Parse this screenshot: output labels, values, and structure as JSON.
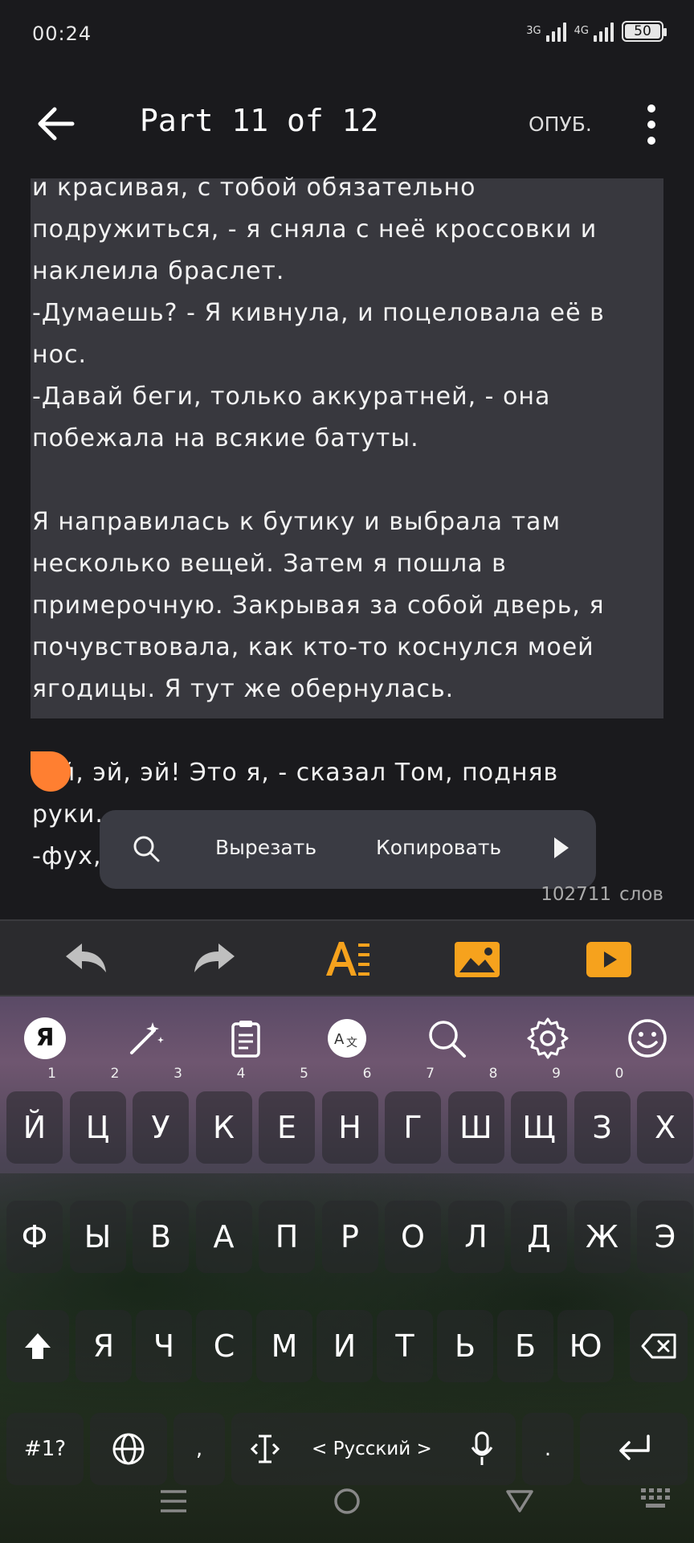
{
  "status_bar": {
    "time": "00:24",
    "net1": "3G",
    "net2": "4G",
    "battery": "50"
  },
  "toolbar": {
    "title": "Part 11 of 12",
    "publish_label": "ОПУБ."
  },
  "editor": {
    "lines": [
      "и красивая, с тобой обязательно",
      "подружиться, - я сняла с неё кроссовки и",
      "наклеила браслет.",
      "-Думаешь? - Я кивнула, и поцеловала её в",
      "нос.",
      "-Давай беги, только аккуратней, - она",
      "побежала на всякие батуты.",
      "",
      "Я направилась к бутику и выбрала там",
      "несколько вещей. Затем я пошла в",
      "примерочную. Закрывая за собой дверь, я",
      "почувствовала, как кто-то коснулся моей",
      "ягодицы. Я тут же обернулась.",
      "",
      "-Эй, эй, эй! Это я, - сказал Том, подняв",
      "руки.",
      "-фух, бандит, черт тебя дернул, - я"
    ],
    "word_count": "102711",
    "word_count_unit": "слов"
  },
  "selection_menu": {
    "cut": "Вырезать",
    "copy": "Копировать"
  },
  "format_bar": {
    "icons": [
      "undo-icon",
      "redo-icon",
      "text-format-icon",
      "image-icon",
      "video-icon"
    ],
    "accent": "#f6a21d"
  },
  "keyboard": {
    "row1": [
      {
        "k": "Й",
        "n": "1"
      },
      {
        "k": "Ц",
        "n": "2"
      },
      {
        "k": "У",
        "n": "3"
      },
      {
        "k": "К",
        "n": "4"
      },
      {
        "k": "Е",
        "n": "5"
      },
      {
        "k": "Н",
        "n": "6"
      },
      {
        "k": "Г",
        "n": "7"
      },
      {
        "k": "Ш",
        "n": "8"
      },
      {
        "k": "Щ",
        "n": "9"
      },
      {
        "k": "З",
        "n": "0"
      },
      {
        "k": "Х",
        "n": ""
      }
    ],
    "row2": [
      "Ф",
      "Ы",
      "В",
      "А",
      "П",
      "Р",
      "О",
      "Л",
      "Д",
      "Ж",
      "Э"
    ],
    "row3": [
      "Я",
      "Ч",
      "С",
      "М",
      "И",
      "Т",
      "Ь",
      "Б",
      "Ю"
    ],
    "sym_label": "#1?",
    "comma": ",",
    "period": ".",
    "language": "< Русский >"
  }
}
